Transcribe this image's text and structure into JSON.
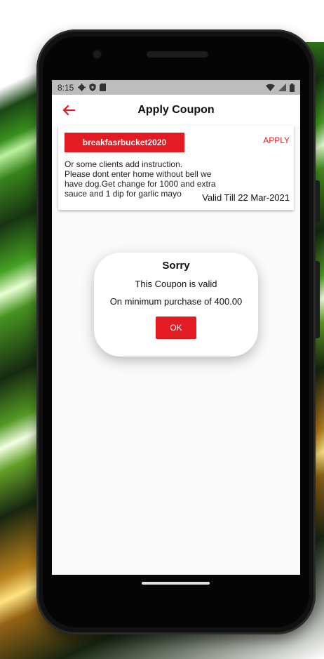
{
  "status_bar": {
    "time": "8:15",
    "left_icons": [
      "gear-icon",
      "shield-icon",
      "sd-card-icon"
    ],
    "right_icons": [
      "wifi-icon",
      "signal-icon",
      "battery-icon"
    ]
  },
  "appbar": {
    "title": "Apply Coupon",
    "back_icon": "arrow-left-icon"
  },
  "coupon": {
    "code": "breakfasrbucket2020",
    "apply_label": "APPLY",
    "instruction": "Or some clients add instruction.\nPlease dont enter home  without bell we have dog.Get change for 1000 and extra sauce and 1 dip for garlic mayo",
    "valid_till": "Valid Till 22 Mar-2021"
  },
  "dialog": {
    "title": "Sorry",
    "message1": "This Coupon is valid",
    "message2": "On minimum purchase of 400.00",
    "ok_label": "OK"
  },
  "colors": {
    "accent": "#e31b23",
    "background": "#fafafa",
    "status_bar": "#bdbdbd"
  }
}
